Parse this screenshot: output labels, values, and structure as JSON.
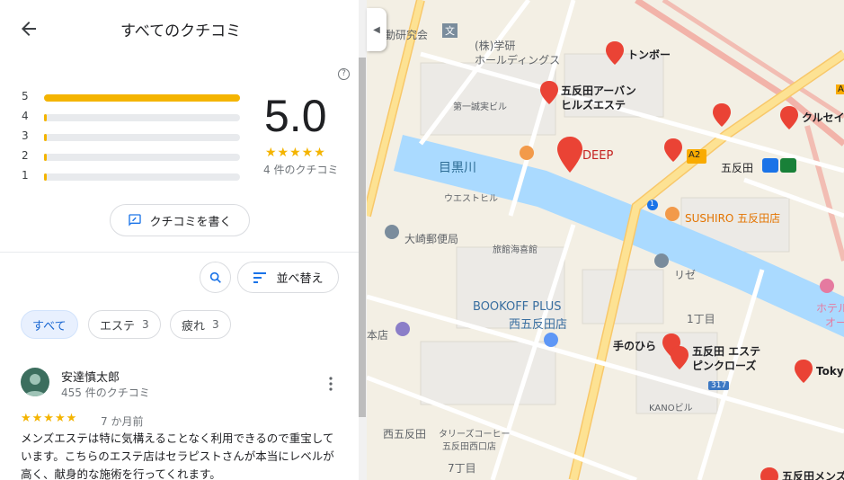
{
  "header": {
    "title": "すべてのクチコミ"
  },
  "summary": {
    "score": "5.0",
    "stars": "★★★★★",
    "review_count": "4 件のクチコミ",
    "help": "?",
    "bars": [
      {
        "label": "5",
        "fraction": 1.0
      },
      {
        "label": "4",
        "fraction": 0.0
      },
      {
        "label": "3",
        "fraction": 0.0
      },
      {
        "label": "2",
        "fraction": 0.0
      },
      {
        "label": "1",
        "fraction": 0.0
      }
    ]
  },
  "actions": {
    "write_review": "クチコミを書く",
    "sort": "並べ替え"
  },
  "chips": [
    {
      "label": "すべて",
      "count": ""
    },
    {
      "label": "エステ",
      "count": "3"
    },
    {
      "label": "疲れ",
      "count": "3"
    }
  ],
  "review": {
    "author": "安達慎太郎",
    "meta": "455 件のクチコミ",
    "stars": "★★★★★",
    "time": "7 か月前",
    "text": "メンズエステは特に気構えることなく利用できるので重宝しています。こちらのエステ店はセラピストさんが本当にレベルが高く、献身的な施術を行ってくれます。"
  },
  "map": {
    "labels": {
      "doubutsu": "動研究会",
      "bunkyo": "文",
      "kabu": "(株)学研",
      "holdings": "ホールディングス",
      "tonbo": "トンボー",
      "urban1": "五反田アーバン",
      "urban2": "ヒルズエステ",
      "daiichi": "第一誠実ビル",
      "deep": "DEEP",
      "kuruse": "クルセイ",
      "a2": "A2",
      "gotanda": "五反田",
      "meguro": "目黒川",
      "westhill": "ウエストヒル",
      "sushiro": "SUSHIRO 五反田店",
      "osaki": "大崎郵便局",
      "ryokan": "旅館海喜館",
      "rize": "リゼ",
      "bookoff1": "BOOKOFF PLUS",
      "bookoff2": "西五反田店",
      "itchome": "1丁目",
      "tenohira": "手のひら",
      "esthe1": "五反田 エステ",
      "esthe2": "ピンクローズ",
      "tky": "Tokyo",
      "honten": "本店",
      "kano": "KANOビル",
      "r317": "317",
      "nishigotanda": "西五反田",
      "tullys1": "タリーズコーヒー",
      "tullys2": "五反田西口店",
      "nanachome": "7丁目",
      "hotel1": "ホテル",
      "hotel2": "オーク",
      "mens": "五反田メンズ",
      "a_edge": "A",
      "r1": "1"
    }
  }
}
